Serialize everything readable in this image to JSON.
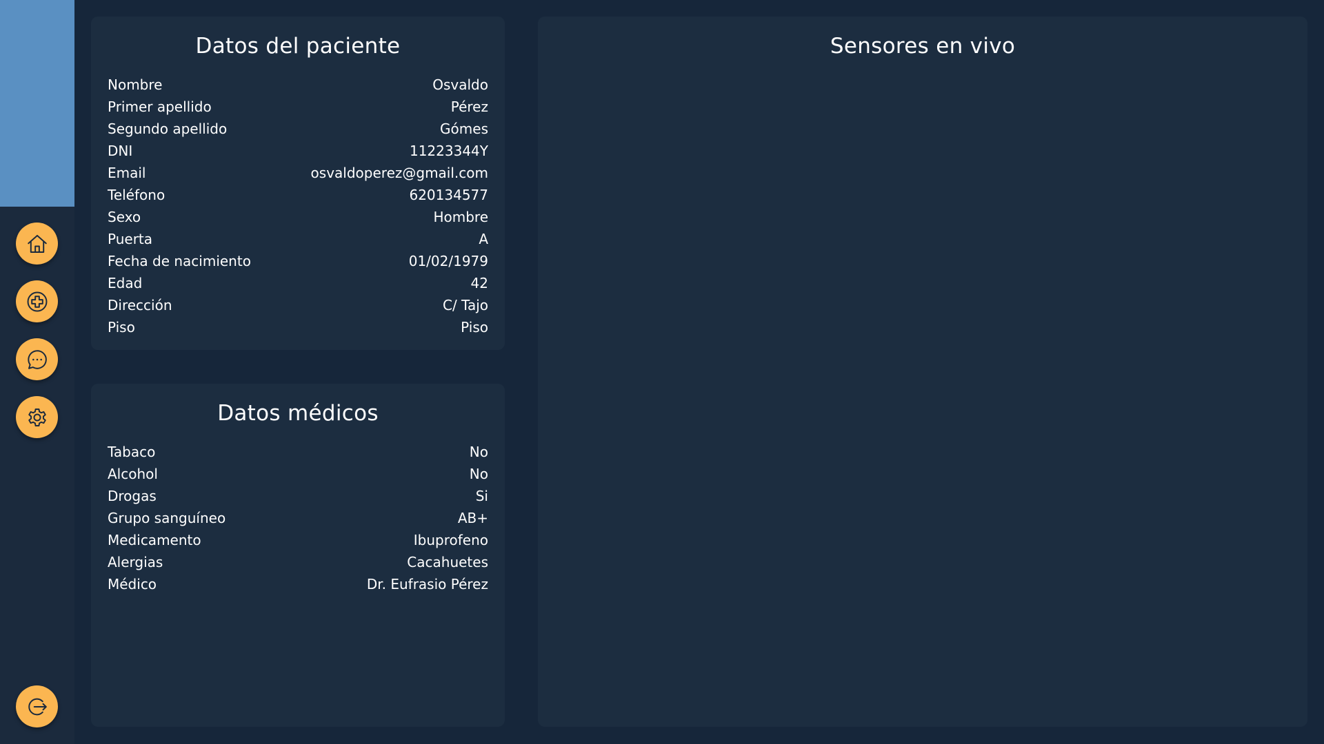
{
  "sidebar": {
    "nav": [
      {
        "icon": "home-icon"
      },
      {
        "icon": "add-icon"
      },
      {
        "icon": "chat-icon"
      },
      {
        "icon": "gear-icon"
      }
    ],
    "logout_icon": "logout-icon",
    "accent_color": "#fbb651",
    "top_color": "#5a90c2"
  },
  "patient": {
    "title": "Datos del paciente",
    "rows": [
      {
        "label": "Nombre",
        "value": "Osvaldo"
      },
      {
        "label": "Primer apellido",
        "value": "Pérez"
      },
      {
        "label": "Segundo apellido",
        "value": "Gómes"
      },
      {
        "label": "DNI",
        "value": "11223344Y"
      },
      {
        "label": "Email",
        "value": "osvaldoperez@gmail.com"
      },
      {
        "label": "Teléfono",
        "value": "620134577"
      },
      {
        "label": "Sexo",
        "value": "Hombre"
      },
      {
        "label": "Puerta",
        "value": "A"
      },
      {
        "label": "Fecha de nacimiento",
        "value": "01/02/1979"
      },
      {
        "label": "Edad",
        "value": "42"
      },
      {
        "label": "Dirección",
        "value": "C/ Tajo"
      },
      {
        "label": "Piso",
        "value": "Piso"
      }
    ]
  },
  "medical": {
    "title": "Datos médicos",
    "rows": [
      {
        "label": "Tabaco",
        "value": "No"
      },
      {
        "label": "Alcohol",
        "value": "No"
      },
      {
        "label": "Drogas",
        "value": "Si"
      },
      {
        "label": "Grupo sanguíneo",
        "value": "AB+"
      },
      {
        "label": "Medicamento",
        "value": "Ibuprofeno"
      },
      {
        "label": "Alergias",
        "value": "Cacahuetes"
      },
      {
        "label": "Médico",
        "value": "Dr. Eufrasio Pérez"
      }
    ]
  },
  "sensors": {
    "title": "Sensores en vivo"
  }
}
